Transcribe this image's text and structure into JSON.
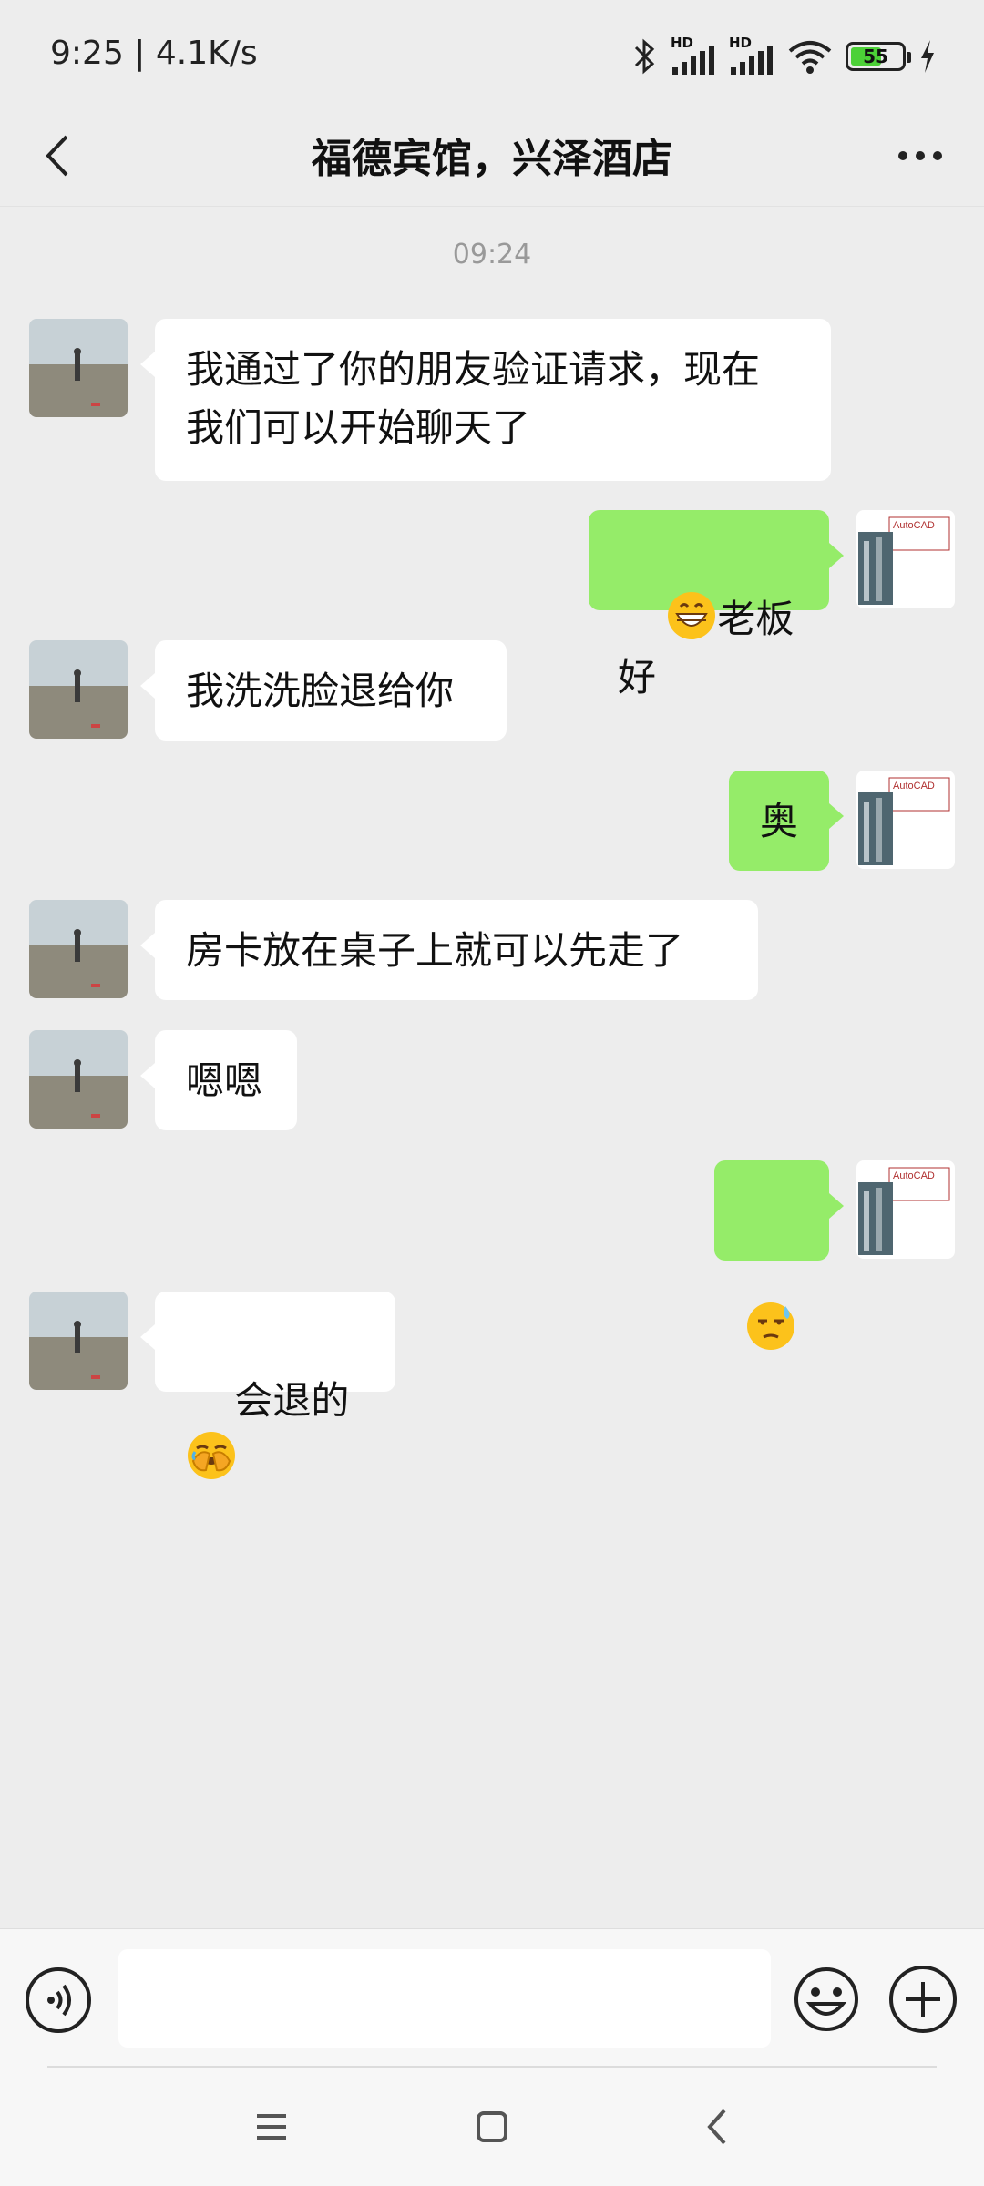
{
  "status_bar": {
    "time": "9:25 | 4.1K/s",
    "network_1": "HD",
    "network_2": "HD",
    "battery": "55"
  },
  "header": {
    "title": "福德宾馆，兴泽酒店"
  },
  "timestamp": "09:24",
  "messages": [
    {
      "side": "left",
      "text": "我通过了你的朋友验证请求，现在\n我们可以开始聊天了"
    },
    {
      "side": "right",
      "emoji": "grinning-face",
      "text": "老板好"
    },
    {
      "side": "left",
      "text": "我洗洗脸退给你"
    },
    {
      "side": "right",
      "text": "奥"
    },
    {
      "side": "left",
      "text": "房卡放在桌子上就可以先走了"
    },
    {
      "side": "left",
      "text": "嗯嗯"
    },
    {
      "side": "right",
      "emoji": "sweat-face",
      "text": ""
    },
    {
      "side": "left",
      "text": "会退的",
      "emoji": "face-palm"
    }
  ],
  "self_avatar_text": "AutoCAD",
  "input": {
    "value": "",
    "placeholder": ""
  },
  "icons": {
    "voice": "voice-icon",
    "emoji": "emoji-icon",
    "plus": "plus-icon",
    "back": "back-icon",
    "more": "more-icon"
  }
}
